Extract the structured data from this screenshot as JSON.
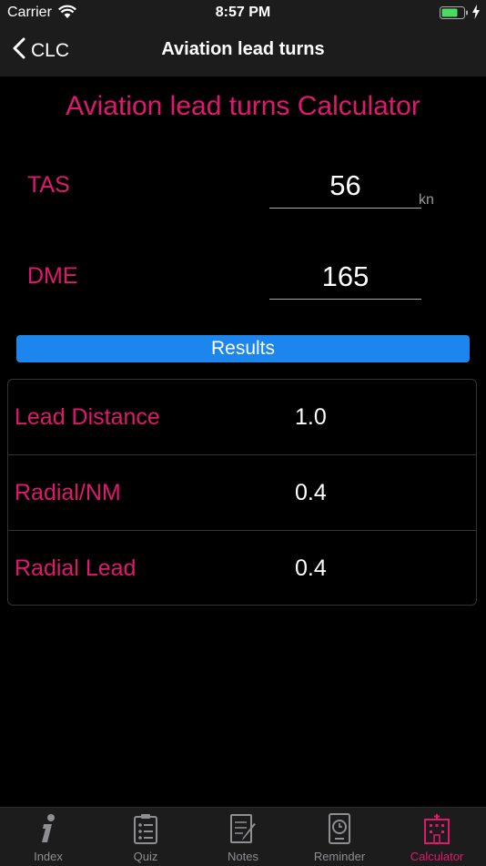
{
  "status_bar": {
    "carrier": "Carrier",
    "time": "8:57 PM"
  },
  "nav": {
    "back_label": "CLC",
    "title": "Aviation lead turns"
  },
  "calculator": {
    "title": "Aviation lead turns Calculator",
    "tas": {
      "label": "TAS",
      "value": "56",
      "unit": "kn"
    },
    "dme": {
      "label": "DME",
      "value": "165"
    },
    "results_button": "Results"
  },
  "results": [
    {
      "label": "Lead Distance",
      "value": "1.0"
    },
    {
      "label": "Radial/NM",
      "value": "0.4"
    },
    {
      "label": "Radial Lead",
      "value": "0.4"
    }
  ],
  "tabs": [
    {
      "label": "Index",
      "icon": "info-icon"
    },
    {
      "label": "Quiz",
      "icon": "clipboard-icon"
    },
    {
      "label": "Notes",
      "icon": "notes-icon"
    },
    {
      "label": "Reminder",
      "icon": "clock-icon"
    },
    {
      "label": "Calculator",
      "icon": "hospital-icon",
      "active": true
    }
  ],
  "colors": {
    "accent": "#e0186f",
    "button": "#1c86ee",
    "bar": "#1c1c1c"
  }
}
